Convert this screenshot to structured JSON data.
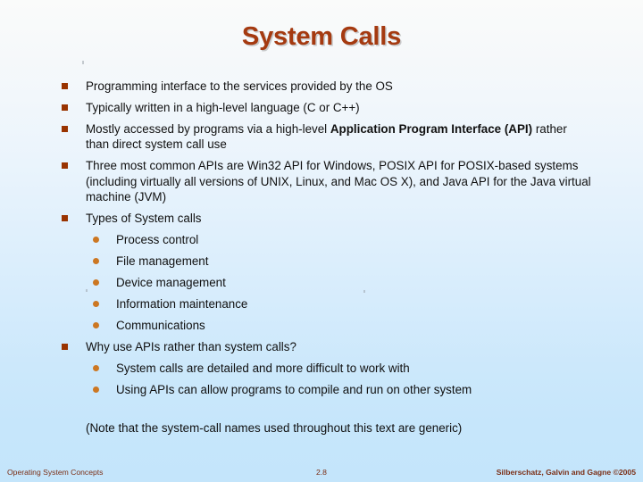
{
  "slide": {
    "title": "System Calls",
    "title_color": "#a53a10",
    "bullet_color": "#993300",
    "subbullet_color": "#cc7722",
    "background_top": "#fafbfa",
    "background_bottom": "#c4e5fb"
  },
  "bullets": [
    {
      "level": 1,
      "text": "Programming interface to the services provided by the OS"
    },
    {
      "level": 1,
      "text": "Typically written in a high-level language (C or C++)"
    },
    {
      "level": 1,
      "parts": [
        {
          "text": "Mostly accessed by programs via a high-level ",
          "bold": false
        },
        {
          "text": "Application Program Interface (API)",
          "bold": true
        },
        {
          "text": " rather than direct system call use",
          "bold": false
        }
      ]
    },
    {
      "level": 1,
      "text": "Three most common APIs are Win32 API for Windows, POSIX API for POSIX-based systems (including virtually all versions of UNIX, Linux, and Mac OS X), and Java API for the Java virtual machine (JVM)"
    },
    {
      "level": 1,
      "text": "Types of System calls"
    },
    {
      "level": 2,
      "text": "Process control"
    },
    {
      "level": 2,
      "text": "File management"
    },
    {
      "level": 2,
      "text": "Device management"
    },
    {
      "level": 2,
      "text": "Information maintenance"
    },
    {
      "level": 2,
      "text": "Communications"
    },
    {
      "level": 1,
      "text": "Why use APIs rather than system calls?"
    },
    {
      "level": 2,
      "text": "System calls are detailed and more difficult to work with"
    },
    {
      "level": 2,
      "text": "Using APIs can allow programs to compile and run on other system"
    }
  ],
  "note": "(Note that the system-call names used throughout this text are generic)",
  "footer": {
    "left": "Operating System Concepts",
    "page": "2.8",
    "right": "Silberschatz, Galvin and Gagne ©2005"
  }
}
